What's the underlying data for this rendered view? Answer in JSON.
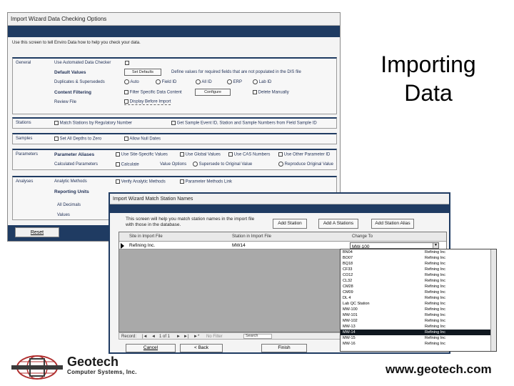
{
  "slide": {
    "heading_line1": "Importing",
    "heading_line2": "Data",
    "url": "www.geotech.com",
    "logo_name": "Geotech",
    "logo_sub": "Computer Systems, Inc."
  },
  "data_checking_window": {
    "title": "Import Wizard   Data Checking Options",
    "intro": "Use this screen to tell Enviro Data how to help you check your data.",
    "general": {
      "label": "General",
      "use_automated": "Use Automated Data Checker",
      "default_values": "Default Values",
      "set_defaults_button": "Set Defaults",
      "define_values_text": "Define values for required fields that are not populated in the DIS file",
      "dups": "Duplicates & Supersededs",
      "dup_options": [
        "Auto",
        "Field ID",
        "All ID",
        "ERP",
        "Lab ID"
      ],
      "content_filtering": "Content Filtering",
      "filter_specific": "Filter Specific Data Content",
      "configure_button": "Configure",
      "delete_manually": "Delete Manually",
      "review_file": "Review File",
      "display_before_import": "Display Before Import"
    },
    "stations": {
      "label": "Stations",
      "match_text": "Match Stations by Regulatory Number",
      "get_sample_text": "Get Sample Event ID, Station and Sample Numbers from Field Sample ID"
    },
    "samples": {
      "label": "Samples",
      "set_depths": "Set All Depths to Zero",
      "allow_null": "Allow Null Dates"
    },
    "parameters": {
      "label": "Parameters",
      "parameter_aliases": "Parameter Aliases",
      "use_site_specific": "Use Site-Specific Values",
      "use_global": "Use Global Values",
      "use_cas": "Use CAS Numbers",
      "use_other": "Use Other Parameter ID",
      "calculated_parameters": "Calculated Parameters",
      "calculate": "Calculate",
      "value_options": "Value Options",
      "supersede_original": "Supersede to Original Value",
      "reproduce_original": "Reproduce Original Value"
    },
    "analyses": {
      "label": "Analyses",
      "analytic_methods": "Analytic Methods",
      "verify_methods": "Verify Analytic Methods",
      "parameter_method_link": "Parameter Methods Link",
      "reporting_units": "Reporting Units",
      "all_decimals": "All Decimals",
      "values": "Values"
    },
    "reset_button": "Reset"
  },
  "match_window": {
    "title": "Import Wizard    Match Station Names",
    "intro_line1": "This screen will help you match station names in the import file",
    "intro_line2": "with those in the database.",
    "add_station_button": "Add Station",
    "add_stations_button": "Add A Stations",
    "add_station_alias_button": "Add Station Alias",
    "col1": "Site in Import File",
    "col2": "Station in Import File",
    "col3": "Change To",
    "row_site": "Refining Inc.",
    "row_station": "MW14",
    "row_change_to": "MW-100",
    "record_label": "Record:",
    "record_nav": "1 of 1",
    "no_filter": "No Filter",
    "search": "Search",
    "cancel_button": "Cancel",
    "back_button": "< Back",
    "finish_button": "Finish"
  },
  "dropdown_items": [
    {
      "station": "BN04",
      "site": "Refining Inc"
    },
    {
      "station": "BO07",
      "site": "Refining Inc"
    },
    {
      "station": "BQ18",
      "site": "Refining Inc"
    },
    {
      "station": "CF33",
      "site": "Refining Inc"
    },
    {
      "station": "CO12",
      "site": "Refining Inc"
    },
    {
      "station": "CL32",
      "site": "Refining Inc"
    },
    {
      "station": "CM28",
      "site": "Refining Inc"
    },
    {
      "station": "CM09",
      "site": "Refining Inc"
    },
    {
      "station": "DL 4",
      "site": "Refining Inc"
    },
    {
      "station": "Lab QC Station",
      "site": "Refining Inc"
    },
    {
      "station": "MW-100",
      "site": "Refining Inc"
    },
    {
      "station": "MW-101",
      "site": "Refining Inc"
    },
    {
      "station": "MW-102",
      "site": "Refining Inc"
    },
    {
      "station": "MW-13",
      "site": "Refining Inc"
    },
    {
      "station": "MW-14",
      "site": "Refining Inc"
    },
    {
      "station": "MW-15",
      "site": "Refining Inc"
    },
    {
      "station": "MW-16",
      "site": "Refining Inc"
    }
  ],
  "colors": {
    "navy": "#1f3b62",
    "highlight": "#101820"
  }
}
